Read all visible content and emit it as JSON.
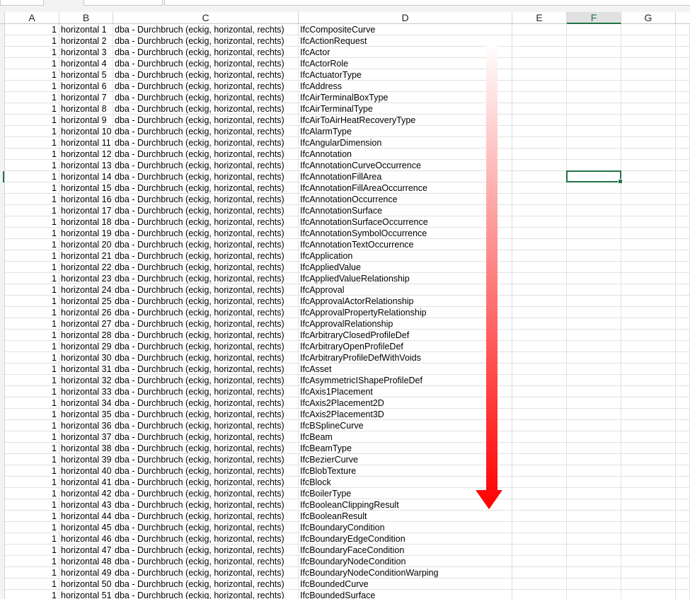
{
  "column_headers": [
    "A",
    "B",
    "C",
    "D",
    "E",
    "F",
    "G"
  ],
  "selected_column": "F",
  "rows": [
    {
      "a": "1",
      "b": "horizontal 1",
      "c": "dba - Durchbruch (eckig, horizontal, rechts)",
      "d": "IfcCompositeCurve"
    },
    {
      "a": "1",
      "b": "horizontal 2",
      "c": "dba - Durchbruch (eckig, horizontal, rechts)",
      "d": "IfcActionRequest"
    },
    {
      "a": "1",
      "b": "horizontal 3",
      "c": "dba - Durchbruch (eckig, horizontal, rechts)",
      "d": "IfcActor"
    },
    {
      "a": "1",
      "b": "horizontal 4",
      "c": "dba - Durchbruch (eckig, horizontal, rechts)",
      "d": "IfcActorRole"
    },
    {
      "a": "1",
      "b": "horizontal 5",
      "c": "dba - Durchbruch (eckig, horizontal, rechts)",
      "d": "IfcActuatorType"
    },
    {
      "a": "1",
      "b": "horizontal 6",
      "c": "dba - Durchbruch (eckig, horizontal, rechts)",
      "d": "IfcAddress"
    },
    {
      "a": "1",
      "b": "horizontal 7",
      "c": "dba - Durchbruch (eckig, horizontal, rechts)",
      "d": "IfcAirTerminalBoxType"
    },
    {
      "a": "1",
      "b": "horizontal 8",
      "c": "dba - Durchbruch (eckig, horizontal, rechts)",
      "d": "IfcAirTerminalType"
    },
    {
      "a": "1",
      "b": "horizontal 9",
      "c": "dba - Durchbruch (eckig, horizontal, rechts)",
      "d": "IfcAirToAirHeatRecoveryType"
    },
    {
      "a": "1",
      "b": "horizontal 10",
      "c": "dba - Durchbruch (eckig, horizontal, rechts)",
      "d": "IfcAlarmType"
    },
    {
      "a": "1",
      "b": "horizontal 11",
      "c": "dba - Durchbruch (eckig, horizontal, rechts)",
      "d": "IfcAngularDimension"
    },
    {
      "a": "1",
      "b": "horizontal 12",
      "c": "dba - Durchbruch (eckig, horizontal, rechts)",
      "d": "IfcAnnotation"
    },
    {
      "a": "1",
      "b": "horizontal 13",
      "c": "dba - Durchbruch (eckig, horizontal, rechts)",
      "d": "IfcAnnotationCurveOccurrence"
    },
    {
      "a": "1",
      "b": "horizontal 14",
      "c": "dba - Durchbruch (eckig, horizontal, rechts)",
      "d": "IfcAnnotationFillArea"
    },
    {
      "a": "1",
      "b": "horizontal 15",
      "c": "dba - Durchbruch (eckig, horizontal, rechts)",
      "d": "IfcAnnotationFillAreaOccurrence"
    },
    {
      "a": "1",
      "b": "horizontal 16",
      "c": "dba - Durchbruch (eckig, horizontal, rechts)",
      "d": "IfcAnnotationOccurrence"
    },
    {
      "a": "1",
      "b": "horizontal 17",
      "c": "dba - Durchbruch (eckig, horizontal, rechts)",
      "d": "IfcAnnotationSurface"
    },
    {
      "a": "1",
      "b": "horizontal 18",
      "c": "dba - Durchbruch (eckig, horizontal, rechts)",
      "d": "IfcAnnotationSurfaceOccurrence"
    },
    {
      "a": "1",
      "b": "horizontal 19",
      "c": "dba - Durchbruch (eckig, horizontal, rechts)",
      "d": "IfcAnnotationSymbolOccurrence"
    },
    {
      "a": "1",
      "b": "horizontal 20",
      "c": "dba - Durchbruch (eckig, horizontal, rechts)",
      "d": "IfcAnnotationTextOccurrence"
    },
    {
      "a": "1",
      "b": "horizontal 21",
      "c": "dba - Durchbruch (eckig, horizontal, rechts)",
      "d": "IfcApplication"
    },
    {
      "a": "1",
      "b": "horizontal 22",
      "c": "dba - Durchbruch (eckig, horizontal, rechts)",
      "d": "IfcAppliedValue"
    },
    {
      "a": "1",
      "b": "horizontal 23",
      "c": "dba - Durchbruch (eckig, horizontal, rechts)",
      "d": "IfcAppliedValueRelationship"
    },
    {
      "a": "1",
      "b": "horizontal 24",
      "c": "dba - Durchbruch (eckig, horizontal, rechts)",
      "d": "IfcApproval"
    },
    {
      "a": "1",
      "b": "horizontal 25",
      "c": "dba - Durchbruch (eckig, horizontal, rechts)",
      "d": "IfcApprovalActorRelationship"
    },
    {
      "a": "1",
      "b": "horizontal 26",
      "c": "dba - Durchbruch (eckig, horizontal, rechts)",
      "d": "IfcApprovalPropertyRelationship"
    },
    {
      "a": "1",
      "b": "horizontal 27",
      "c": "dba - Durchbruch (eckig, horizontal, rechts)",
      "d": "IfcApprovalRelationship"
    },
    {
      "a": "1",
      "b": "horizontal 28",
      "c": "dba - Durchbruch (eckig, horizontal, rechts)",
      "d": "IfcArbitraryClosedProfileDef"
    },
    {
      "a": "1",
      "b": "horizontal 29",
      "c": "dba - Durchbruch (eckig, horizontal, rechts)",
      "d": "IfcArbitraryOpenProfileDef"
    },
    {
      "a": "1",
      "b": "horizontal 30",
      "c": "dba - Durchbruch (eckig, horizontal, rechts)",
      "d": "IfcArbitraryProfileDefWithVoids"
    },
    {
      "a": "1",
      "b": "horizontal 31",
      "c": "dba - Durchbruch (eckig, horizontal, rechts)",
      "d": "IfcAsset"
    },
    {
      "a": "1",
      "b": "horizontal 32",
      "c": "dba - Durchbruch (eckig, horizontal, rechts)",
      "d": "IfcAsymmetricIShapeProfileDef"
    },
    {
      "a": "1",
      "b": "horizontal 33",
      "c": "dba - Durchbruch (eckig, horizontal, rechts)",
      "d": "IfcAxis1Placement"
    },
    {
      "a": "1",
      "b": "horizontal 34",
      "c": "dba - Durchbruch (eckig, horizontal, rechts)",
      "d": "IfcAxis2Placement2D"
    },
    {
      "a": "1",
      "b": "horizontal 35",
      "c": "dba - Durchbruch (eckig, horizontal, rechts)",
      "d": "IfcAxis2Placement3D"
    },
    {
      "a": "1",
      "b": "horizontal 36",
      "c": "dba - Durchbruch (eckig, horizontal, rechts)",
      "d": "IfcBSplineCurve"
    },
    {
      "a": "1",
      "b": "horizontal 37",
      "c": "dba - Durchbruch (eckig, horizontal, rechts)",
      "d": "IfcBeam"
    },
    {
      "a": "1",
      "b": "horizontal 38",
      "c": "dba - Durchbruch (eckig, horizontal, rechts)",
      "d": "IfcBeamType"
    },
    {
      "a": "1",
      "b": "horizontal 39",
      "c": "dba - Durchbruch (eckig, horizontal, rechts)",
      "d": "IfcBezierCurve"
    },
    {
      "a": "1",
      "b": "horizontal 40",
      "c": "dba - Durchbruch (eckig, horizontal, rechts)",
      "d": "IfcBlobTexture"
    },
    {
      "a": "1",
      "b": "horizontal 41",
      "c": "dba - Durchbruch (eckig, horizontal, rechts)",
      "d": "IfcBlock"
    },
    {
      "a": "1",
      "b": "horizontal 42",
      "c": "dba - Durchbruch (eckig, horizontal, rechts)",
      "d": "IfcBoilerType"
    },
    {
      "a": "1",
      "b": "horizontal 43",
      "c": "dba - Durchbruch (eckig, horizontal, rechts)",
      "d": "IfcBooleanClippingResult"
    },
    {
      "a": "1",
      "b": "horizontal 44",
      "c": "dba - Durchbruch (eckig, horizontal, rechts)",
      "d": "IfcBooleanResult"
    },
    {
      "a": "1",
      "b": "horizontal 45",
      "c": "dba - Durchbruch (eckig, horizontal, rechts)",
      "d": "IfcBoundaryCondition"
    },
    {
      "a": "1",
      "b": "horizontal 46",
      "c": "dba - Durchbruch (eckig, horizontal, rechts)",
      "d": "IfcBoundaryEdgeCondition"
    },
    {
      "a": "1",
      "b": "horizontal 47",
      "c": "dba - Durchbruch (eckig, horizontal, rechts)",
      "d": "IfcBoundaryFaceCondition"
    },
    {
      "a": "1",
      "b": "horizontal 48",
      "c": "dba - Durchbruch (eckig, horizontal, rechts)",
      "d": "IfcBoundaryNodeCondition"
    },
    {
      "a": "1",
      "b": "horizontal 49",
      "c": "dba - Durchbruch (eckig, horizontal, rechts)",
      "d": "IfcBoundaryNodeConditionWarping"
    },
    {
      "a": "1",
      "b": "horizontal 50",
      "c": "dba - Durchbruch (eckig, horizontal, rechts)",
      "d": "IfcBoundedCurve"
    },
    {
      "a": "1",
      "b": "horizontal 51",
      "c": "dba - Durchbruch (eckig, horizontal, rechts)",
      "d": "IfcBoundedSurface"
    }
  ],
  "colors": {
    "accent": "#217346",
    "arrow_top": "#ffffff",
    "arrow_bottom": "#ff0000",
    "gridline": "#e1e1e1"
  },
  "annotation": {
    "icon": "down-arrow-icon"
  }
}
